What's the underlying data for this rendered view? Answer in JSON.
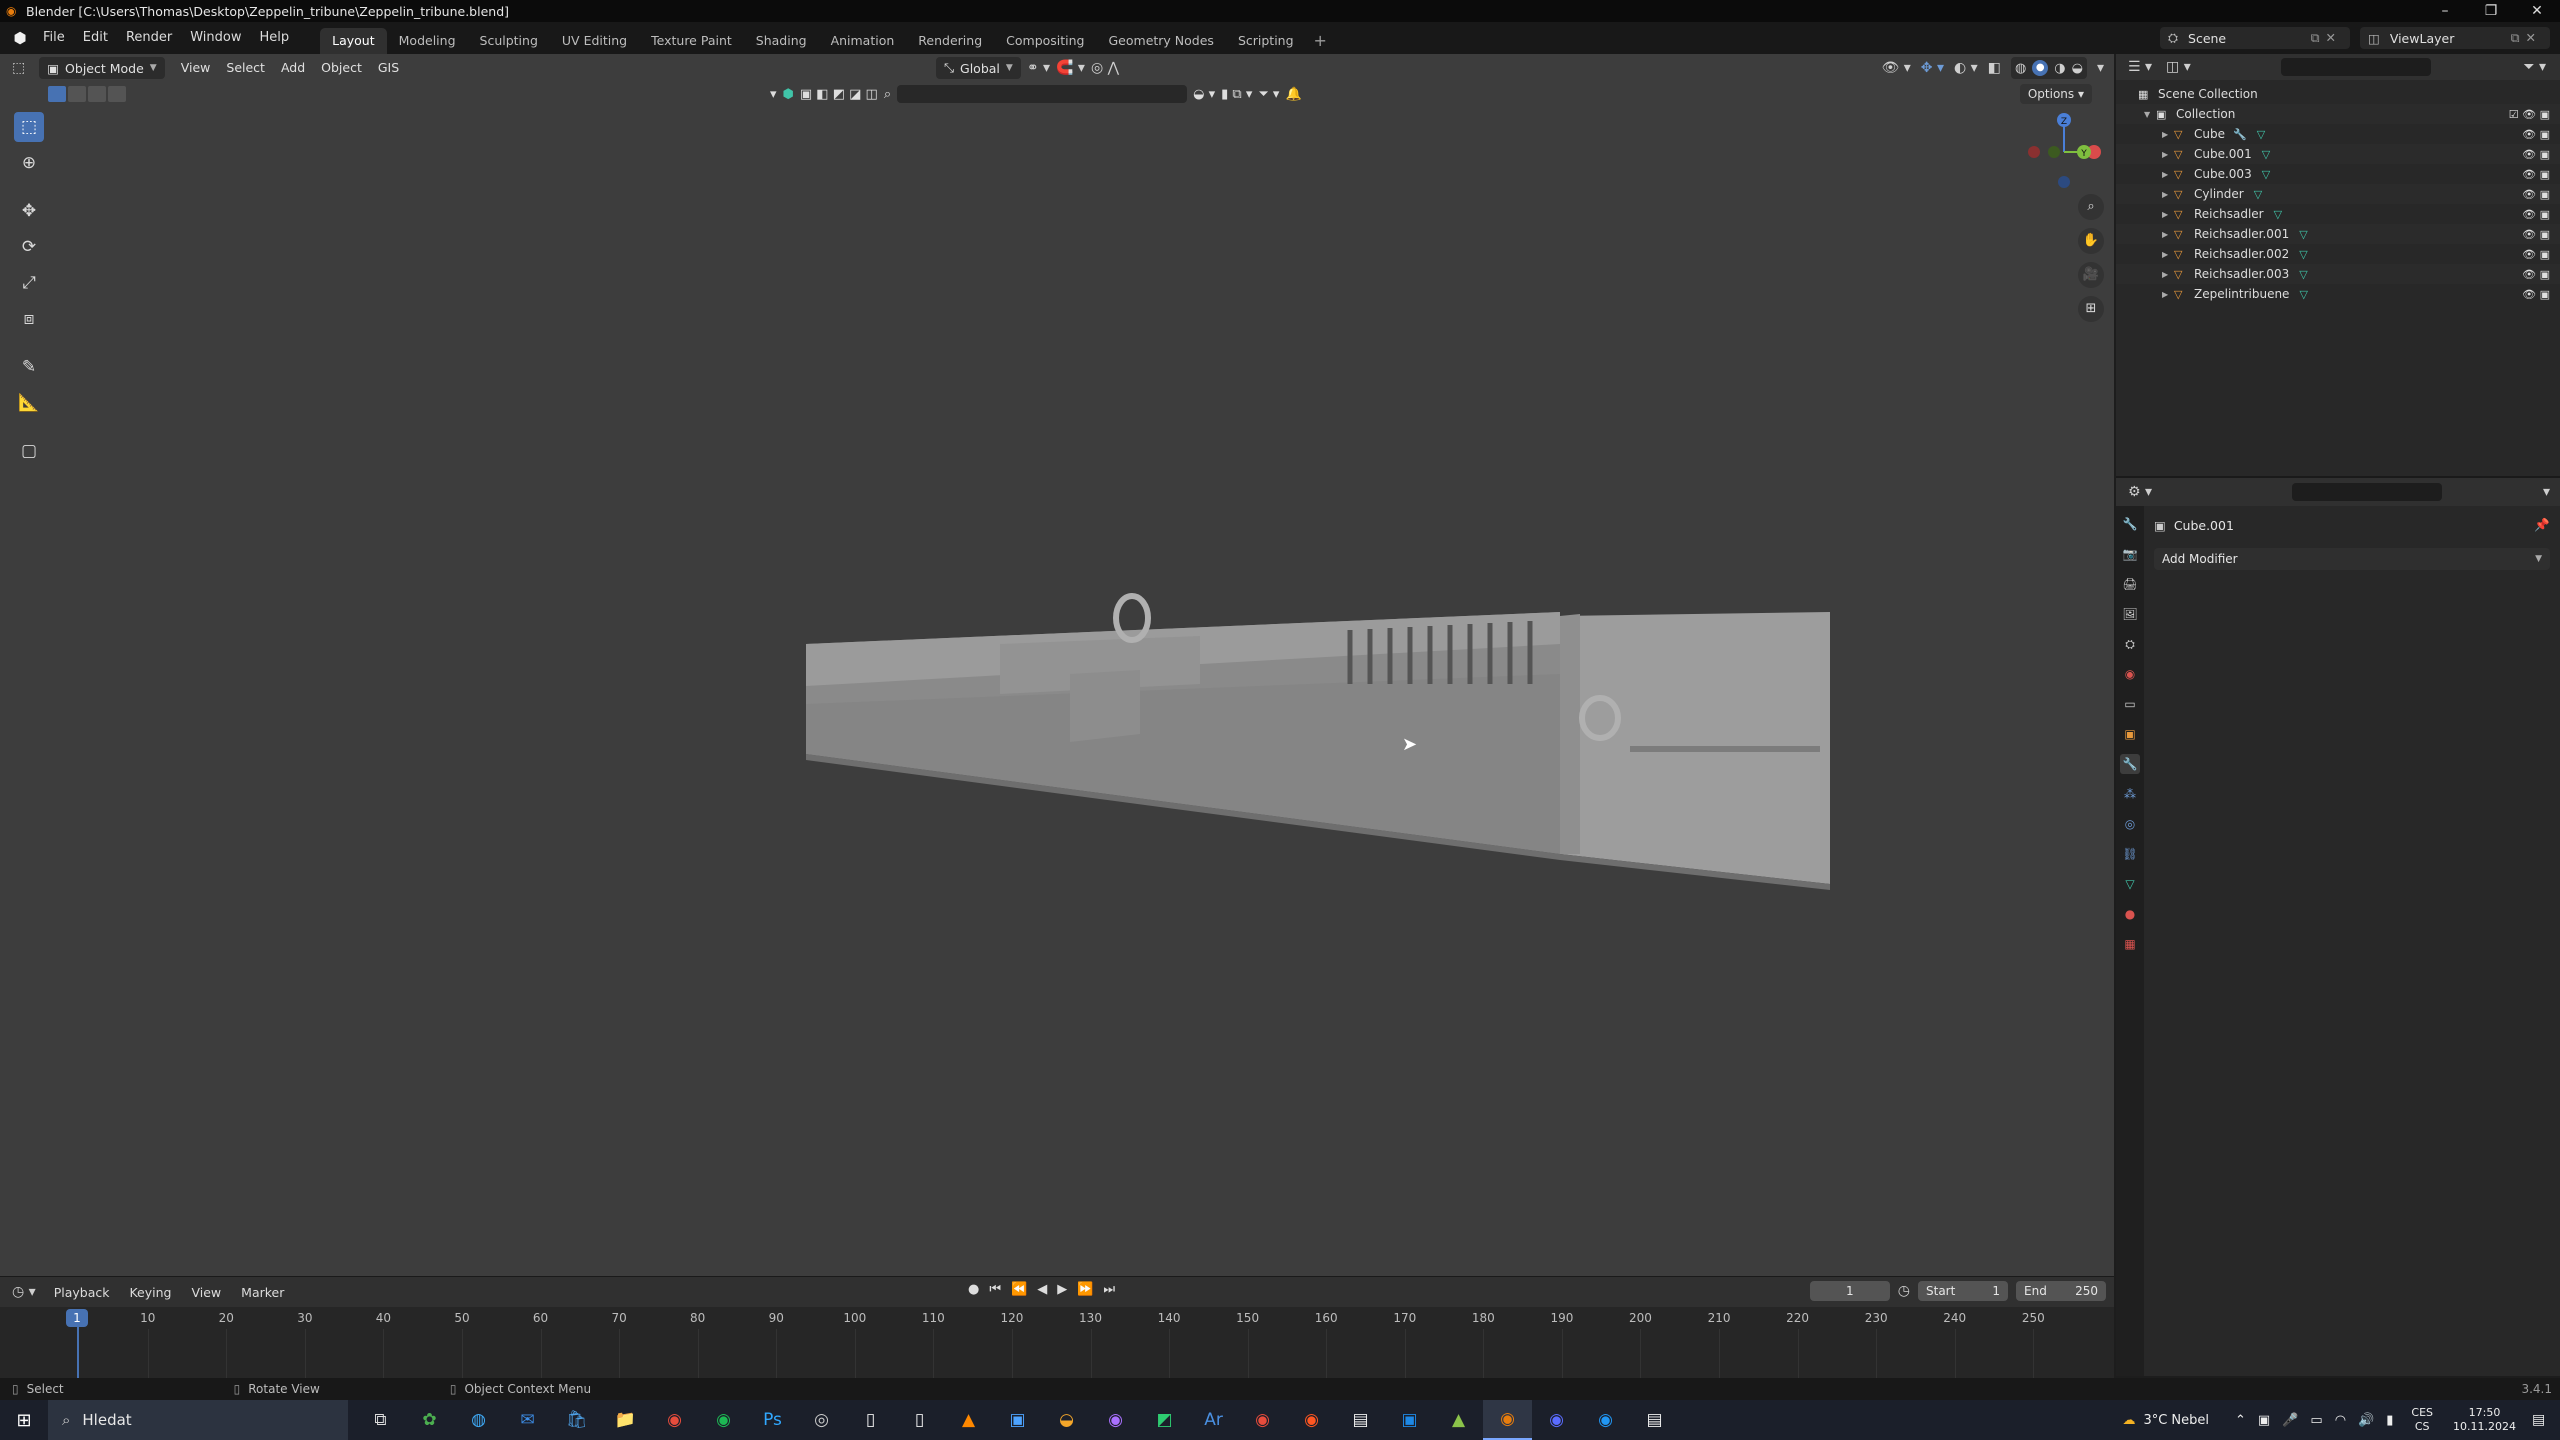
{
  "window": {
    "title": "Blender [C:\\Users\\Thomas\\Desktop\\Zeppelin_tribune\\Zeppelin_tribune.blend]",
    "controls": [
      "–",
      "❐",
      "✕"
    ]
  },
  "menubar": {
    "items": [
      "File",
      "Edit",
      "Render",
      "Window",
      "Help"
    ],
    "workspaces": [
      "Layout",
      "Modeling",
      "Sculpting",
      "UV Editing",
      "Texture Paint",
      "Shading",
      "Animation",
      "Rendering",
      "Compositing",
      "Geometry Nodes",
      "Scripting"
    ],
    "active_workspace": "Layout",
    "scene": "Scene",
    "view_layer": "ViewLayer"
  },
  "viewport": {
    "mode": "Object Mode",
    "menus": [
      "View",
      "Select",
      "Add",
      "Object",
      "GIS"
    ],
    "transform_orientation": "Global",
    "options_label": "Options"
  },
  "timeline": {
    "menus": [
      "Playback",
      "Keying",
      "View",
      "Marker"
    ],
    "current_frame": "1",
    "start_label": "Start",
    "start": "1",
    "end_label": "End",
    "end": "250",
    "ticks": [
      "10",
      "20",
      "30",
      "40",
      "50",
      "60",
      "70",
      "80",
      "90",
      "100",
      "110",
      "120",
      "130",
      "140",
      "150",
      "160",
      "170",
      "180",
      "190",
      "200",
      "210",
      "220",
      "230",
      "240",
      "250"
    ]
  },
  "outliner": {
    "scene_collection": "Scene Collection",
    "collection": "Collection",
    "objects": [
      "Cube",
      "Cube.001",
      "Cube.003",
      "Cylinder",
      "Reichsadler",
      "Reichsadler.001",
      "Reichsadler.002",
      "Reichsadler.003",
      "Zepelintribuene"
    ]
  },
  "properties": {
    "object_name": "Cube.001",
    "add_modifier": "Add Modifier"
  },
  "statusbar": {
    "select": "Select",
    "rotate": "Rotate View",
    "context": "Object Context Menu",
    "version": "3.4.1"
  },
  "taskbar": {
    "search_placeholder": "Hledat",
    "weather": "3°C  Nebel",
    "lang_top": "CES",
    "lang_bottom": "CS",
    "time": "17:50",
    "date": "10.11.2024"
  },
  "colors": {
    "accent": "#4772b3",
    "viewport_bg": "#3d3d3d",
    "object_orange": "#e8993c",
    "mesh_green": "#40c4a8"
  }
}
